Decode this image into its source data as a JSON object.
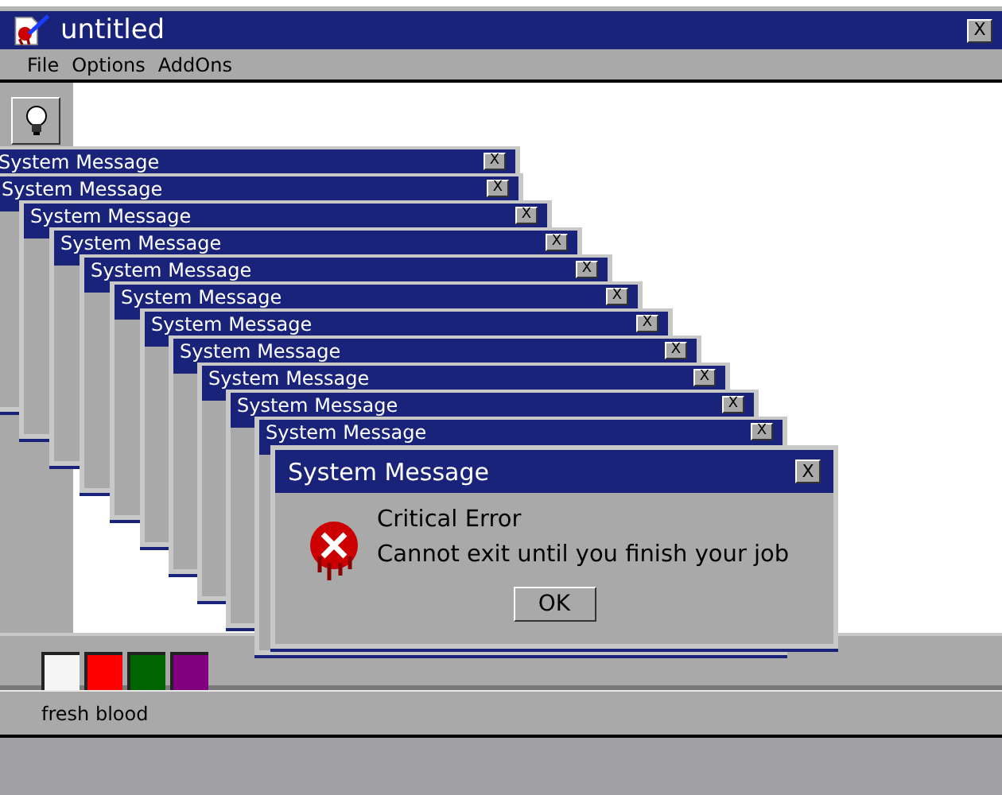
{
  "window": {
    "title": "untitled",
    "close": "X"
  },
  "menu": [
    "File",
    "Options",
    "AddOns"
  ],
  "stacked_dialogs": [
    {
      "title": "System Message",
      "close": "X"
    },
    {
      "title": "System Message",
      "close": "X"
    },
    {
      "title": "System Message",
      "close": "X"
    },
    {
      "title": "System Message",
      "close": "X"
    },
    {
      "title": "System Message",
      "close": "X"
    },
    {
      "title": "System Message",
      "close": "X"
    },
    {
      "title": "System Message",
      "close": "X"
    },
    {
      "title": "System Message",
      "close": "X"
    },
    {
      "title": "System Message",
      "close": "X"
    },
    {
      "title": "System Message",
      "close": "X"
    },
    {
      "title": "System Message",
      "close": "X"
    }
  ],
  "dialog": {
    "title": "System Message",
    "close": "X",
    "heading": "Critical Error",
    "message": "Cannot exit until you finish your job",
    "button": "OK"
  },
  "palette": [
    {
      "color": "#f5f5f5"
    },
    {
      "color": "#ff0000"
    },
    {
      "color": "#006400"
    },
    {
      "color": "#800080"
    }
  ],
  "status_bar": "fresh blood"
}
